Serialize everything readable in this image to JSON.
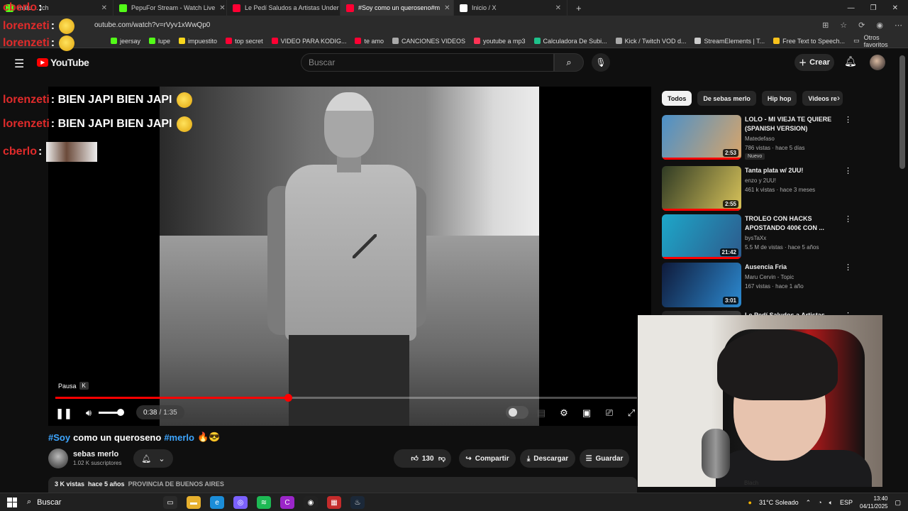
{
  "browser": {
    "tabs": [
      {
        "label": "mafu… tch",
        "color": "#53fc18"
      },
      {
        "label": "PepuFor Stream - Watch Live",
        "color": "#53fc18"
      },
      {
        "label": "Le Pedí Saludos a Artistas Under",
        "color": "#ff0033"
      },
      {
        "label": "#Soy como un queroseno#m",
        "color": "#ff0033"
      },
      {
        "label": "Inicio / X",
        "color": "#ffffff"
      }
    ],
    "new_tab": "+",
    "url": "outube.com/watch?v=rVyv1xWwQp0",
    "bookmarks": [
      {
        "label": "jeersay",
        "color": "#53fc18"
      },
      {
        "label": "lupe",
        "color": "#53fc18"
      },
      {
        "label": "impuestito",
        "color": "#f9d71c"
      },
      {
        "label": "top secret",
        "color": "#ff0033"
      },
      {
        "label": "VIDEO PARA KODIG...",
        "color": "#ff0033"
      },
      {
        "label": "te amo",
        "color": "#ff0033"
      },
      {
        "label": "CANCIONES VIDEOS",
        "color": "#aaaaaa"
      },
      {
        "label": "youtube a mp3",
        "color": "#ff3355"
      },
      {
        "label": "Calculadora De Subi...",
        "color": "#1ec28b"
      },
      {
        "label": "Kick / Twitch VOD d...",
        "color": "#aaaaaa"
      },
      {
        "label": "StreamElements | T...",
        "color": "#cccccc"
      },
      {
        "label": "Free Text to Speech...",
        "color": "#f9c21c"
      }
    ],
    "other_bookmarks": "Otros favoritos"
  },
  "youtube": {
    "logo": "YouTube",
    "search_placeholder": "Buscar",
    "create_label": "Crear"
  },
  "player": {
    "tooltip": "Pausa",
    "tooltip_key": "K",
    "current_time": "0:38",
    "separator": "/",
    "duration": "1:35",
    "progress": 0.4,
    "volume": 0.85
  },
  "video": {
    "hashtag1": "#Soy",
    "title_mid": "como un queroseno",
    "hashtag2": "#merlo",
    "title_emoji": "🔥😎",
    "channel": "sebas merlo",
    "subscribers": "1.02 K suscriptores",
    "likes": "130",
    "share": "Compartir",
    "download": "Descargar",
    "save": "Guardar",
    "views": "3 K vistas",
    "age": "hace 5 años",
    "location": "PROVINCIA DE BUENOS AIRES"
  },
  "chips": [
    "Todos",
    "De sebas merlo",
    "Hip hop",
    "Videos re"
  ],
  "recommendations": [
    {
      "title": "LOLO - MI VIEJA TE QUIERE (SPANISH VERSION)",
      "channel": "Matedefaso",
      "meta": "786 vistas · hace 5 días",
      "duration": "2:53",
      "badge": "Nuevo",
      "thumb_a": "#4a90c9",
      "thumb_b": "#d8a56a",
      "progress": 1
    },
    {
      "title": "Tanta plata w/ 2UU!",
      "channel": "enzo y 2UU!",
      "meta": "461 k vistas · hace 3 meses",
      "duration": "2:55",
      "badge": "",
      "thumb_a": "#2f3a24",
      "thumb_b": "#d8c35a",
      "progress": 1
    },
    {
      "title": "TROLEO CON HACKS APOSTANDO 400€ CON ...",
      "channel": "bysTaXx",
      "meta": "5.5 M de vistas · hace 5 años",
      "duration": "21:42",
      "badge": "",
      "thumb_a": "#1da7c9",
      "thumb_b": "#2d5a8c",
      "progress": 1
    },
    {
      "title": "Ausencia Fria",
      "channel": "Maru Cervin - Topic",
      "meta": "167 vistas · hace 1 año",
      "duration": "3:01",
      "badge": "",
      "thumb_a": "#0f1a3a",
      "thumb_b": "#2c8ad1",
      "progress": 0
    },
    {
      "title": "Le Pedí Saludos a Artistas",
      "channel": "",
      "meta": "",
      "duration": "",
      "badge": "",
      "thumb_a": "#222222",
      "thumb_b": "#444444",
      "progress": 0
    }
  ],
  "overlay_chat": [
    {
      "user": "cberlo",
      "msg": ":"
    },
    {
      "user": "lorenzeti",
      "msg": ":"
    },
    {
      "user": "lorenzeti",
      "msg": ":"
    },
    {
      "user": "lorenzeti",
      "msg": ": BIEN JAPI BIEN JAPI"
    },
    {
      "user": "lorenzeti",
      "msg": ": BIEN JAPI BIEN JAPI"
    },
    {
      "user": "cberlo",
      "msg": ":"
    }
  ],
  "webcam_caption": "Blach",
  "taskbar": {
    "search": "Buscar",
    "weather": "31°C  Soleado",
    "lang": "ESP",
    "time": "13:40",
    "date": "04/11/2025"
  }
}
